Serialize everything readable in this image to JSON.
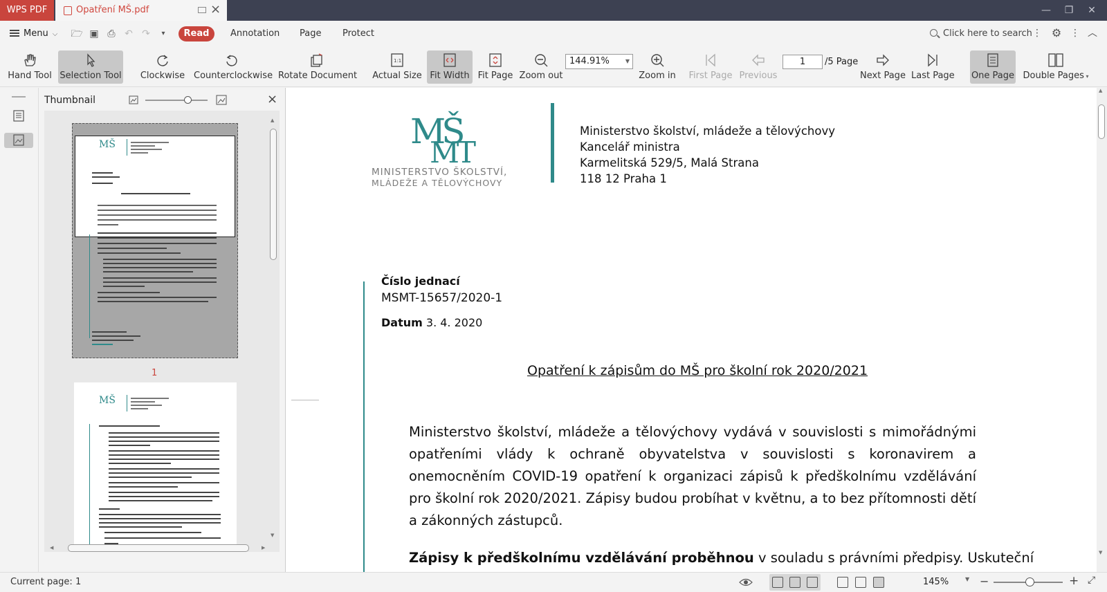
{
  "titlebar": {
    "app_name": "WPS PDF",
    "doc_tab": "Opatření MŠ.pdf"
  },
  "menubar": {
    "menu": "Menu",
    "tabs": [
      "Read",
      "Annotation",
      "Page",
      "Protect"
    ],
    "search_placeholder": "Click here to search"
  },
  "toolbar": {
    "hand": "Hand Tool",
    "selection": "Selection Tool",
    "clockwise": "Clockwise",
    "counterclockwise": "Counterclockwise",
    "rotate_document": "Rotate Document",
    "actual_size": "Actual Size",
    "fit_width": "Fit Width",
    "fit_page": "Fit Page",
    "zoom_out": "Zoom out",
    "zoom_value": "144.91%",
    "zoom_in": "Zoom in",
    "first_page": "First Page",
    "previous": "Previous",
    "page_current": "1",
    "page_total": "/5 Page",
    "next_page": "Next Page",
    "last_page": "Last Page",
    "one_page": "One Page",
    "double_pages": "Double Pages"
  },
  "thumbnail": {
    "title": "Thumbnail",
    "page1_label": "1"
  },
  "document": {
    "logo_line1": "MINISTERSTVO ŠKOLSTVÍ,",
    "logo_line2": "MLÁDEŽE A TĚLOVÝCHOVY",
    "address": [
      "Ministerstvo školství, mládeže a tělovýchovy",
      "Kancelář ministra",
      "Karmelitská 529/5, Malá Strana",
      "118 12 Praha 1"
    ],
    "ref_label": "Číslo jednací",
    "ref_value": "MSMT-15657/2020-1",
    "date_label": "Datum",
    "date_value": "3. 4. 2020",
    "title": "Opatření k zápisům do MŠ pro školní rok 2020/2021",
    "paragraph": "Ministerstvo školství, mládeže a tělovýchovy vydává v souvislosti s mimořádnými opatřeními vlády k ochraně obyvatelstva v souvislosti s koronavirem a onemocněním COVID-19 opatření k organizaci zápisů k předškolnímu vzdělávání pro školní rok 2020/2021. Zápisy budou probíhat v květnu, a to bez přítomnosti dětí a zákonných zástupců.",
    "para2_bold": "Zápisy k předškolnímu vzdělávání proběhnou",
    "para2_rest": " v souladu s právními předpisy. Uskuteční"
  },
  "status": {
    "current_page": "Current page: 1",
    "zoom": "145%"
  },
  "colors": {
    "brand_red": "#c9453d",
    "logo_teal": "#2f8a8a",
    "titlebar_bg": "#3d4152"
  }
}
